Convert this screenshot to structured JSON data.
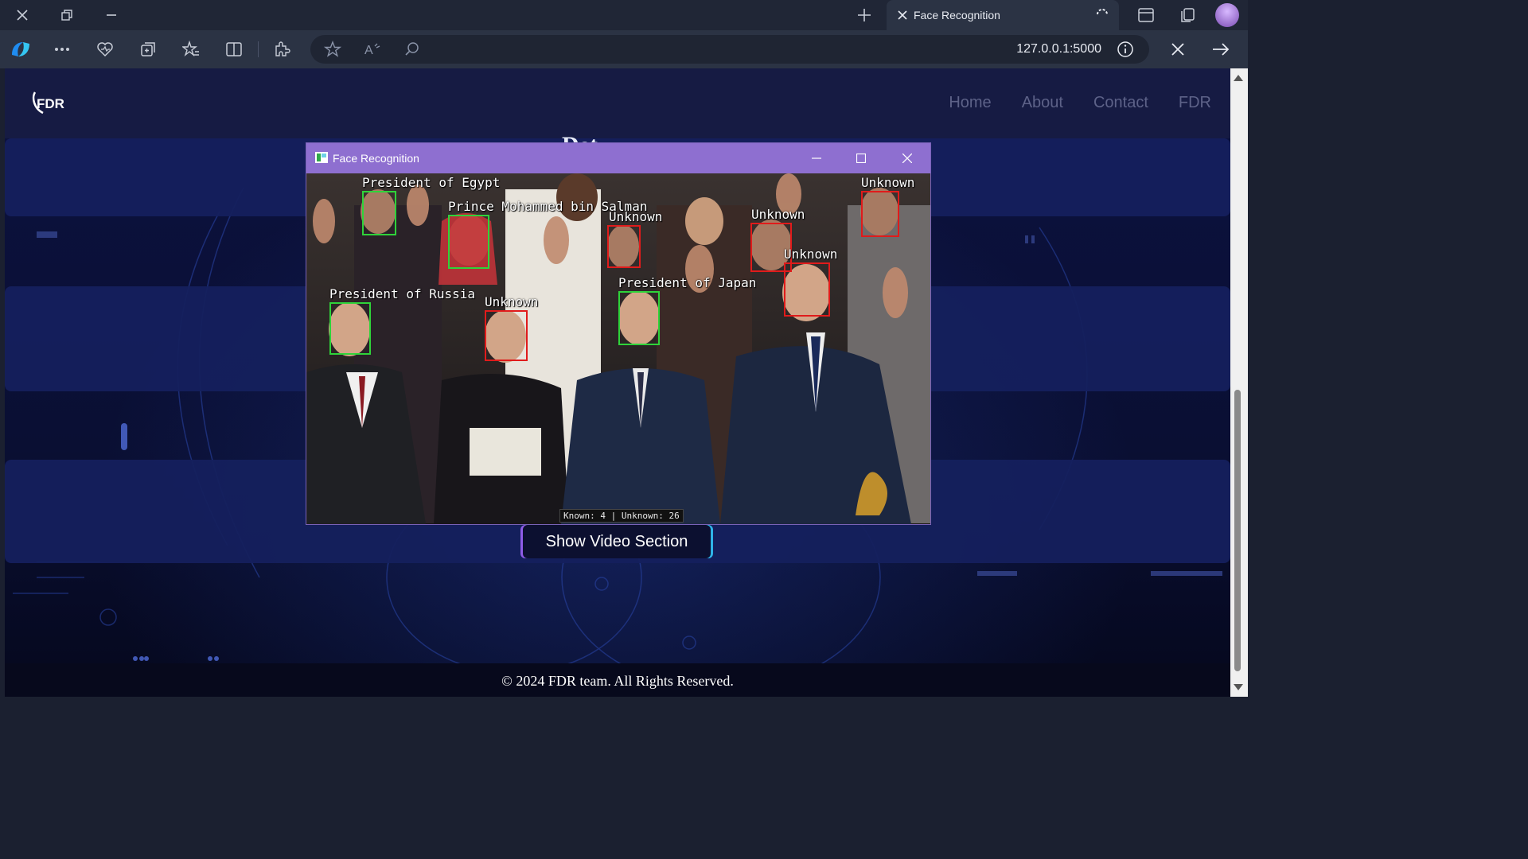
{
  "browser": {
    "tab_title": "Face Recognition",
    "url": "127.0.0.1:5000",
    "icons": [
      "close-icon",
      "restore-icon",
      "minimize-icon",
      "new-tab-icon",
      "loading-icon",
      "split-screen-icon",
      "collections-icon",
      "profile-avatar",
      "copilot-icon",
      "more-icon",
      "health-icon",
      "extensions-icon",
      "favorites-icon",
      "split-view-icon",
      "puzzle-icon",
      "star-icon",
      "read-aloud-icon",
      "search-page-icon",
      "info-icon",
      "stop-icon",
      "forward-icon"
    ]
  },
  "site": {
    "logo_text": "FDR",
    "nav": [
      "Home",
      "About",
      "Contact",
      "FDR"
    ],
    "heading_peek": "Det",
    "show_button": "Show Video Section",
    "footer": "© 2024 FDR team. All Rights Reserved."
  },
  "fr_window": {
    "title": "Face Recognition",
    "faces": [
      {
        "label": "President of Egypt",
        "status": "known"
      },
      {
        "label": "Prince Mohammed bin Salman",
        "status": "known"
      },
      {
        "label": "Unknown",
        "status": "unknown"
      },
      {
        "label": "Unknown",
        "status": "unknown"
      },
      {
        "label": "Unknown",
        "status": "unknown"
      },
      {
        "label": "Unknown",
        "status": "unknown"
      },
      {
        "label": "President of Russia",
        "status": "known"
      },
      {
        "label": "Unknown",
        "status": "unknown"
      },
      {
        "label": "President of Japan",
        "status": "known"
      }
    ],
    "counter": "Known: 4 | Unknown: 26"
  },
  "colors": {
    "known_box": "#2fd33a",
    "unknown_box": "#e01b1b",
    "title_bar": "#8e6fd0",
    "page_bg": "#0c1240"
  }
}
